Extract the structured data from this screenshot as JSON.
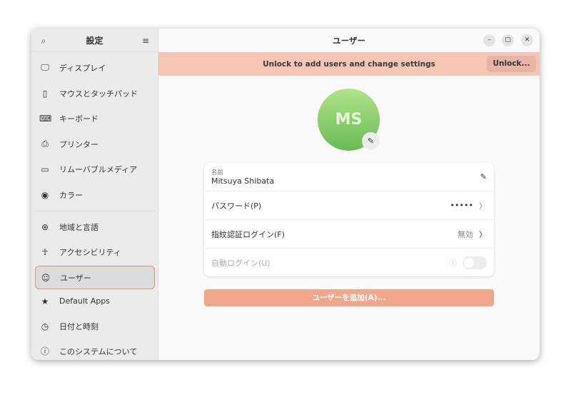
{
  "sidebar": {
    "title": "設定",
    "items": [
      {
        "label": "ディスプレイ",
        "icon": "display-icon"
      },
      {
        "label": "マウスとタッチパッド",
        "icon": "mouse-icon"
      },
      {
        "label": "キーボード",
        "icon": "keyboard-icon"
      },
      {
        "label": "プリンター",
        "icon": "printer-icon"
      },
      {
        "label": "リムーバブルメディア",
        "icon": "removable-media-icon"
      },
      {
        "label": "カラー",
        "icon": "color-icon"
      },
      {
        "label": "地域と言語",
        "icon": "globe-icon"
      },
      {
        "label": "アクセシビリティ",
        "icon": "accessibility-icon"
      },
      {
        "label": "ユーザー",
        "icon": "users-icon",
        "selected": true
      },
      {
        "label": "Default Apps",
        "icon": "star-icon"
      },
      {
        "label": "日付と時刻",
        "icon": "clock-icon"
      },
      {
        "label": "このシステムについて",
        "icon": "info-icon"
      }
    ]
  },
  "header": {
    "title": "ユーザー"
  },
  "banner": {
    "text": "Unlock to add users and change settings",
    "button": "Unlock..."
  },
  "user": {
    "initials": "MS",
    "name_label": "名前",
    "name": "Mitsuya Shibata",
    "password_label": "パスワード(P)",
    "password_value": "•••••",
    "fingerprint_label": "指紋認証ログイン(F)",
    "fingerprint_value": "無効",
    "autologin_label": "自動ログイン(U)",
    "autologin_enabled": false
  },
  "add_user": "ユーザーを追加(A)...",
  "colors": {
    "accent": "#e95420",
    "banner": "#f5c5b6",
    "avatar": "#8fd06f"
  }
}
